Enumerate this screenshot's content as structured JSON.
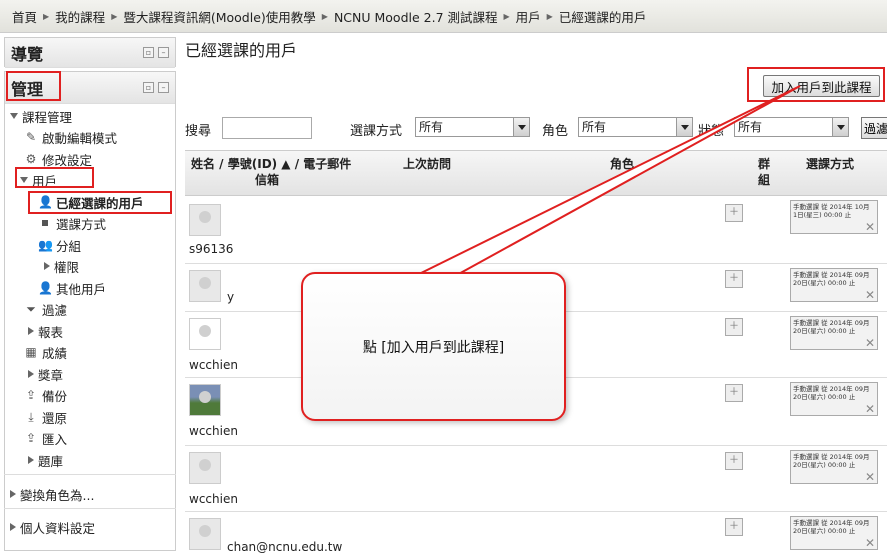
{
  "breadcrumb": [
    "首頁",
    "我的課程",
    "暨大課程資訊網(Moodle)使用教學",
    "NCNU Moodle 2.7 測試課程",
    "用戶",
    "已經選課的用戶"
  ],
  "nav_block": {
    "title": "導覽"
  },
  "admin_block": {
    "title": "管理",
    "items": [
      "課程管理",
      "啟動編輯模式",
      "修改設定",
      "用戶",
      "已經選課的用戶",
      "選課方式",
      "分組",
      "權限",
      "其他用戶",
      "過濾",
      "報表",
      "成績",
      "獎章",
      "備份",
      "還原",
      "匯入",
      "題庫",
      "變換角色為...",
      "個人資料設定"
    ]
  },
  "page": {
    "title": "已經選課的用戶",
    "add_button": "加入用戶到此課程"
  },
  "filters": {
    "search_label": "搜尋",
    "enrol_label": "選課方式",
    "enrol_value": "所有",
    "role_label": "角色",
    "role_value": "所有",
    "status_label": "狀態",
    "status_value": "所有",
    "filter_button": "過濾"
  },
  "table": {
    "col_name": "姓名 / 學號(ID) ▲ / 電子郵件",
    "col_name2": "信箱",
    "col_last": "上次訪問",
    "col_role": "角色",
    "col_group": "群",
    "col_group2": "組",
    "col_enrol": "選課方式",
    "rows": [
      {
        "userid": "s96136",
        "email": "",
        "enrol": "手動選課 從 2014年 10月 1日(星三) 00:00 止"
      },
      {
        "userid": "",
        "email": "y",
        "enrol": "手動選課 從 2014年 09月 20日(星六) 00:00 止"
      },
      {
        "userid": "wcchien",
        "email": "",
        "enrol": "手動選課 從 2014年 09月 20日(星六) 00:00 止"
      },
      {
        "userid": "wcchien",
        "email": "",
        "enrol": "手動選課 從 2014年 09月 20日(星六) 00:00 止"
      },
      {
        "userid": "wcchien",
        "email": "",
        "enrol": "手動選課 從 2014年 09月 20日(星六) 00:00 止"
      },
      {
        "userid": "",
        "email": "chan@ncnu.edu.tw",
        "enrol": "手動選課 從 2014年 09月 20日(星六) 00:00 止"
      }
    ]
  },
  "callout": {
    "text": "點 [加入用戶到此課程]"
  }
}
